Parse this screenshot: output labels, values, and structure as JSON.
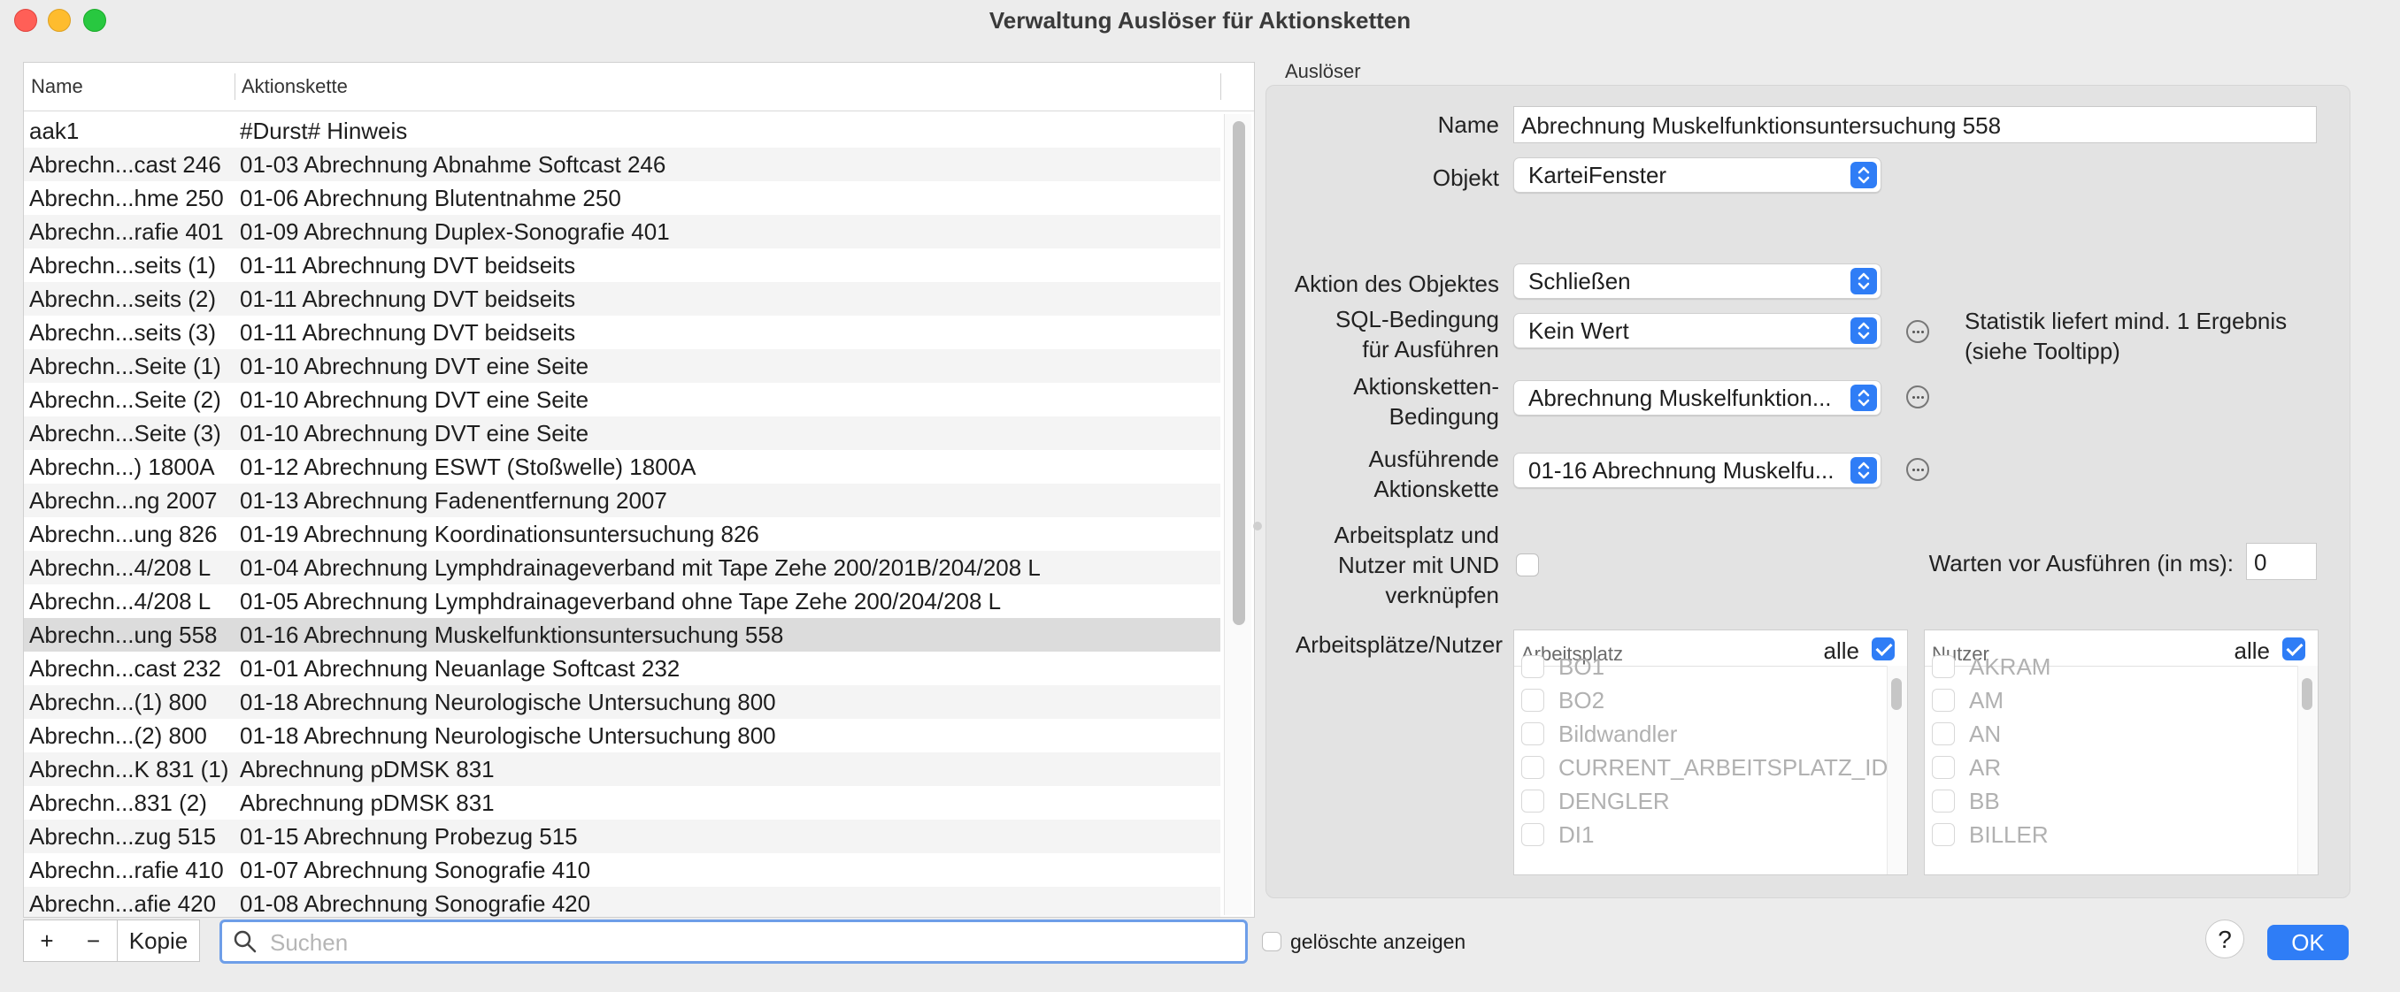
{
  "window": {
    "title": "Verwaltung Auslöser für Aktionsketten"
  },
  "table": {
    "columns": {
      "name": "Name",
      "chain": "Aktionskette"
    },
    "rows": [
      {
        "name": "aak1",
        "chain": "#Durst# Hinweis"
      },
      {
        "name": "Abrechn...cast 246",
        "chain": "01-03 Abrechnung Abnahme Softcast 246"
      },
      {
        "name": "Abrechn...hme 250",
        "chain": "01-06 Abrechnung Blutentnahme 250"
      },
      {
        "name": "Abrechn...rafie 401",
        "chain": "01-09 Abrechnung Duplex-Sonografie 401"
      },
      {
        "name": "Abrechn...seits (1)",
        "chain": "01-11 Abrechnung DVT beidseits"
      },
      {
        "name": "Abrechn...seits (2)",
        "chain": "01-11 Abrechnung DVT beidseits"
      },
      {
        "name": "Abrechn...seits (3)",
        "chain": "01-11 Abrechnung DVT beidseits"
      },
      {
        "name": "Abrechn...Seite (1)",
        "chain": "01-10 Abrechnung DVT eine Seite"
      },
      {
        "name": "Abrechn...Seite (2)",
        "chain": "01-10 Abrechnung DVT eine Seite"
      },
      {
        "name": "Abrechn...Seite (3)",
        "chain": "01-10 Abrechnung DVT eine Seite"
      },
      {
        "name": "Abrechn...) 1800A",
        "chain": "01-12 Abrechnung ESWT (Stoßwelle) 1800A"
      },
      {
        "name": "Abrechn...ng 2007",
        "chain": "01-13 Abrechnung Fadenentfernung 2007"
      },
      {
        "name": "Abrechn...ung 826",
        "chain": "01-19 Abrechnung Koordinationsuntersuchung 826"
      },
      {
        "name": "Abrechn...4/208 L",
        "chain": "01-04 Abrechnung Lymphdrainageverband mit Tape Zehe 200/201B/204/208 L"
      },
      {
        "name": "Abrechn...4/208 L",
        "chain": "01-05 Abrechnung Lymphdrainageverband ohne Tape Zehe 200/204/208 L"
      },
      {
        "name": "Abrechn...ung 558",
        "chain": "01-16 Abrechnung Muskelfunktionsuntersuchung 558"
      },
      {
        "name": "Abrechn...cast 232",
        "chain": "01-01 Abrechnung Neuanlage Softcast 232"
      },
      {
        "name": "Abrechn...(1) 800",
        "chain": "01-18 Abrechnung Neurologische Untersuchung 800"
      },
      {
        "name": "Abrechn...(2) 800",
        "chain": "01-18 Abrechnung Neurologische Untersuchung 800"
      },
      {
        "name": "Abrechn...K 831 (1)",
        "chain": "Abrechnung pDMSK 831"
      },
      {
        "name": "Abrechn...831 (2)",
        "chain": "Abrechnung pDMSK 831"
      },
      {
        "name": "Abrechn...zug 515",
        "chain": "01-15 Abrechnung Probezug 515"
      },
      {
        "name": "Abrechn...rafie 410",
        "chain": "01-07 Abrechnung Sonografie 410"
      },
      {
        "name": "Abrechn...afie 420",
        "chain": "01-08 Abrechnung Sonografie 420"
      }
    ],
    "selected_index": 15
  },
  "controls": {
    "add": "+",
    "remove": "−",
    "copy": "Kopie",
    "search_placeholder": "Suchen"
  },
  "group": {
    "label": "Auslöser",
    "name_label": "Name",
    "name_value": "Abrechnung Muskelfunktionsuntersuchung 558",
    "object_label": "Objekt",
    "object_value": "KarteiFenster",
    "action_label": "Aktion des Objektes",
    "action_value": "Schließen",
    "sql_label_1": "SQL-Bedingung",
    "sql_label_2": "für Ausführen",
    "sql_value": "Kein Wert",
    "sql_hint_1": "Statistik liefert mind. 1 Ergebnis",
    "sql_hint_2": "(siehe Tooltipp)",
    "chain_cond_label_1": "Aktionsketten-",
    "chain_cond_label_2": "Bedingung",
    "chain_cond_value": "Abrechnung Muskelfunktion...",
    "exec_label_1": "Ausführende",
    "exec_label_2": "Aktionskette",
    "exec_value": "01-16 Abrechnung Muskelfu...",
    "link_label_1": "Arbeitsplatz und",
    "link_label_2": "Nutzer mit UND",
    "link_label_3": "verknüpfen",
    "wait_label": "Warten vor Ausführen (in ms):",
    "wait_value": "0",
    "wp_label": "Arbeitsplätze/Nutzer"
  },
  "workplaces": {
    "header": "Arbeitsplatz",
    "all_label": "alle",
    "items": [
      "BO1",
      "BO2",
      "Bildwandler",
      "CURRENT_ARBEITSPLATZ_ID",
      "DENGLER",
      "DI1"
    ]
  },
  "users": {
    "header": "Nutzer",
    "all_label": "alle",
    "items": [
      "AKRAM",
      "AM",
      "AN",
      "AR",
      "BB",
      "BILLER"
    ]
  },
  "footer": {
    "show_deleted": "gelöschte anzeigen",
    "help": "?",
    "ok": "OK"
  },
  "colors": {
    "accent": "#2f7df6",
    "selection": "#dcdcdc"
  }
}
